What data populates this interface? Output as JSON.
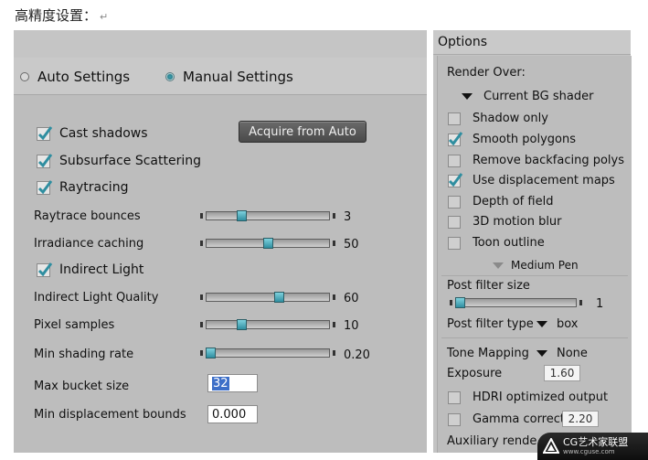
{
  "doc": {
    "title": "高精度设置：",
    "return_mark": "↵"
  },
  "mode": {
    "auto_label": "Auto Settings",
    "manual_label": "Manual Settings",
    "selected": "manual"
  },
  "checks": {
    "cast_shadows": "Cast shadows",
    "subsurface": "Subsurface Scattering",
    "raytracing": "Raytracing",
    "indirect_light": "Indirect Light"
  },
  "acquire_button": "Acquire from Auto",
  "sliders": [
    {
      "label": "Raytrace bounces",
      "value": "3",
      "fraction": 0.27
    },
    {
      "label": "Irradiance caching",
      "value": "50",
      "fraction": 0.5
    },
    {
      "label": "Indirect Light Quality",
      "value": "60",
      "fraction": 0.6
    },
    {
      "label": "Pixel samples",
      "value": "10",
      "fraction": 0.27
    },
    {
      "label": "Min shading rate",
      "value": "0.20",
      "fraction": 0.0
    }
  ],
  "fields": {
    "max_bucket_label": "Max bucket size",
    "max_bucket_value": "32",
    "min_disp_label": "Min displacement bounds",
    "min_disp_value": "0.000"
  },
  "options": {
    "header": "Options",
    "render_over_label": "Render Over:",
    "render_over_value": "Current BG shader",
    "items": [
      {
        "label": "Shadow only",
        "checked": false
      },
      {
        "label": "Smooth polygons",
        "checked": true
      },
      {
        "label": "Remove backfacing polys",
        "checked": false
      },
      {
        "label": "Use displacement maps",
        "checked": true
      },
      {
        "label": "Depth of field",
        "checked": false
      },
      {
        "label": "3D motion blur",
        "checked": false
      },
      {
        "label": "Toon outline",
        "checked": false
      }
    ],
    "toon_style": "Medium Pen",
    "post_filter_size_label": "Post filter size",
    "post_filter_size_value": "1",
    "post_filter_size_fraction": 0.0,
    "post_filter_type_label": "Post filter type",
    "post_filter_type_value": "box",
    "tone_mapping_label": "Tone Mapping",
    "tone_mapping_value": "None",
    "exposure_label": "Exposure",
    "exposure_value": "1.60",
    "hdri_label": "HDRI optimized output",
    "gamma_label": "Gamma correction",
    "gamma_value": "2.20",
    "auxiliary_label": "Auxiliary rende"
  },
  "watermark": {
    "main": "CG艺术家联盟",
    "url": "www.cguse.com"
  },
  "colors": {
    "accent": "#3aa0b0",
    "check": "#2f8ea0",
    "button": "#545454"
  }
}
